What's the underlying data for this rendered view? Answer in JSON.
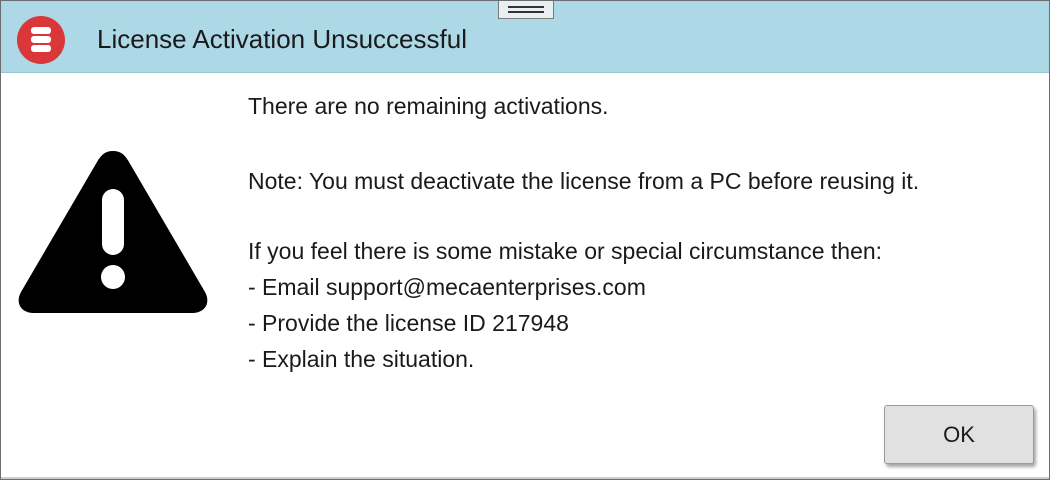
{
  "dialog": {
    "title": "License Activation Unsuccessful",
    "app_icon": "red-database-stack-icon",
    "warning_icon": "warning-triangle-icon",
    "message": {
      "line1": "There are no remaining activations.",
      "line2": "Note: You must deactivate the license from a PC before reusing it.",
      "line3": "If you feel there is some mistake or special circumstance then:",
      "bullet1": " - Email support@mecaenterprises.com",
      "bullet2": " - Provide the license ID 217948",
      "bullet3": " - Explain the situation."
    },
    "ok_label": "OK"
  },
  "colors": {
    "titlebar": "#add8e6",
    "app_icon_red": "#d9373a",
    "button_bg": "#e1e1e1"
  }
}
